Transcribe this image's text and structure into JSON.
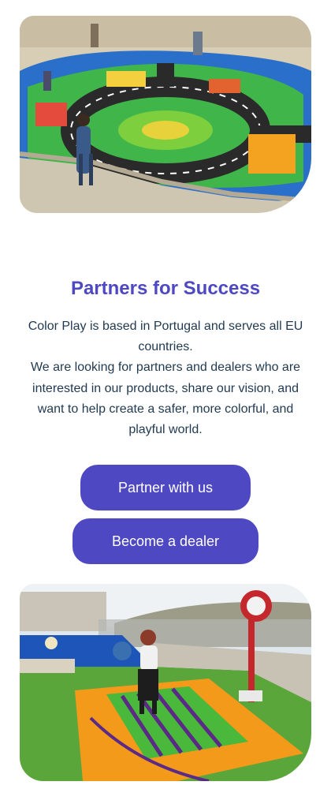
{
  "section": {
    "title": "Partners for Success",
    "paragraph_1": "Color Play is based in Portugal and serves all EU countries.",
    "paragraph_2": "We are looking for partners and dealers who are interested in our products, share our vision, and want to help create a safer, more colorful, and playful world."
  },
  "buttons": {
    "partner_label": "Partner with us",
    "dealer_label": "Become a dealer"
  },
  "colors": {
    "accent": "#4e48c2",
    "text": "#1f3950",
    "background": "#ffffff"
  },
  "images": {
    "top": "colorful-playground-road-map-photo",
    "bottom": "piano-floor-game-playground-photo"
  }
}
